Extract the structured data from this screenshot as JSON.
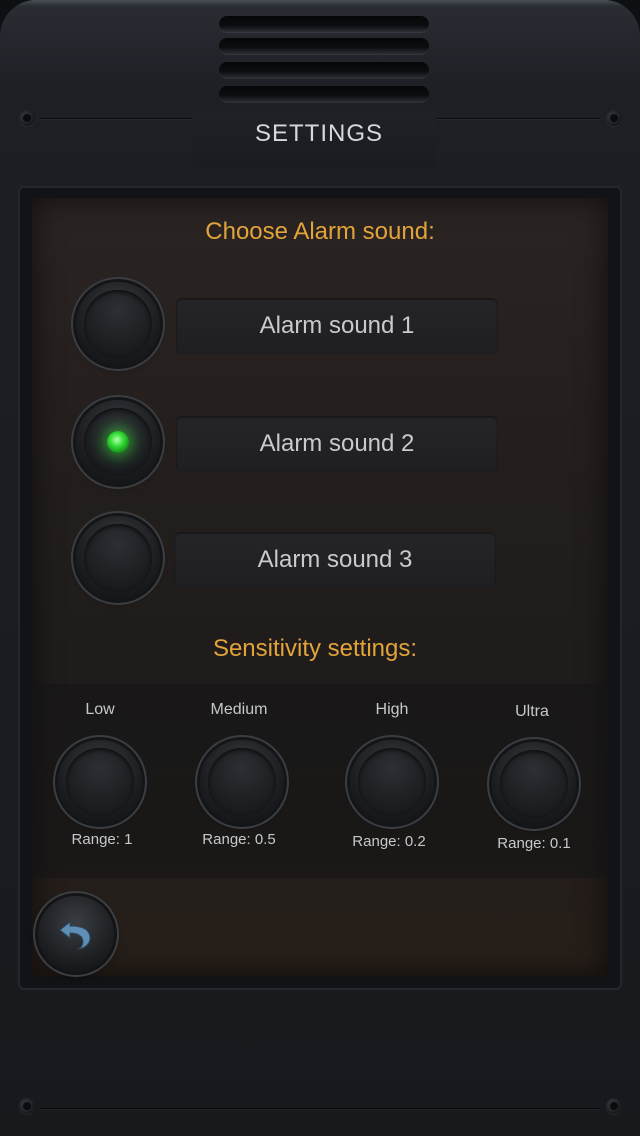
{
  "header": {
    "title": "SETTINGS"
  },
  "alarm": {
    "heading": "Choose Alarm sound:",
    "options": [
      {
        "label": "Alarm sound  1",
        "selected": false
      },
      {
        "label": "Alarm sound 2",
        "selected": true
      },
      {
        "label": "Alarm sound 3",
        "selected": false
      }
    ]
  },
  "sensitivity": {
    "heading": "Sensitivity settings:",
    "options": [
      {
        "name": "Low",
        "range": "Range: 1",
        "selected": false
      },
      {
        "name": "Medium",
        "range": "Range: 0.5",
        "selected": false
      },
      {
        "name": "High",
        "range": "Range: 0.2",
        "selected": false
      },
      {
        "name": "Ultra",
        "range": "Range: 0.1",
        "selected": false
      }
    ]
  },
  "footer": {
    "back_icon": "undo-arrow-icon"
  },
  "colors": {
    "heading": "#e2a33b",
    "led_active": "#37e03a",
    "text": "#c9cacc",
    "back_arrow": "#5f8fb5"
  }
}
